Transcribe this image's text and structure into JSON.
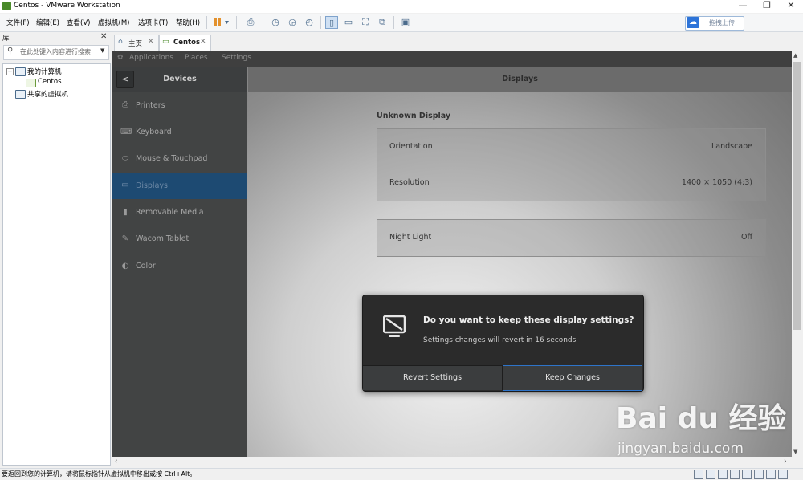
{
  "window": {
    "title": "Centos - VMware Workstation",
    "minimize": "—",
    "restore": "❐",
    "close": "✕"
  },
  "menu": [
    "文件(F)",
    "编辑(E)",
    "查看(V)",
    "虚拟机(M)",
    "选项卡(T)",
    "帮助(H)"
  ],
  "toolbar": {
    "upload_label": "拖拽上传",
    "icons": [
      "pause-icon",
      "send-keys-icon",
      "snapshot-icon",
      "snapshot-revert-icon",
      "snapshot-manager-icon",
      "console-view-icon",
      "unity-icon",
      "fullscreen-icon",
      "full-screen-switch-icon",
      "console-only-icon"
    ]
  },
  "library": {
    "title": "库",
    "close": "✕",
    "search_placeholder": "在此处键入内容进行搜索",
    "tree": {
      "root": "我的计算机",
      "child": "Centos",
      "shared": "共享的虚拟机"
    }
  },
  "tabs": [
    {
      "label": "主页",
      "close": "✕"
    },
    {
      "label": "Centos",
      "close": "✕"
    }
  ],
  "gnome": {
    "applications": "Applications",
    "places": "Places",
    "settings": "Settings"
  },
  "devices": {
    "title": "Devices",
    "back": "<",
    "items": [
      {
        "label": "Printers",
        "icon": "printer-icon"
      },
      {
        "label": "Keyboard",
        "icon": "keyboard-icon"
      },
      {
        "label": "Mouse & Touchpad",
        "icon": "mouse-icon"
      },
      {
        "label": "Displays",
        "icon": "display-icon",
        "selected": true
      },
      {
        "label": "Removable Media",
        "icon": "media-icon"
      },
      {
        "label": "Wacom Tablet",
        "icon": "tablet-icon"
      },
      {
        "label": "Color",
        "icon": "color-icon"
      }
    ]
  },
  "displays": {
    "title": "Displays",
    "monitor_name": "Unknown Display",
    "orientation_label": "Orientation",
    "orientation_value": "Landscape",
    "resolution_label": "Resolution",
    "resolution_value": "1400 × 1050 (4:3)",
    "night_light_label": "Night Light",
    "night_light_value": "Off"
  },
  "dialog": {
    "title": "Do you want to keep these display settings?",
    "subtitle": "Settings changes will revert in 16 seconds",
    "revert_label": "Revert Settings",
    "keep_label": "Keep Changes"
  },
  "watermark": {
    "logo": "Bai du 经验",
    "url": "jingyan.baidu.com"
  },
  "status": {
    "text": "要返回到您的计算机，请将鼠标指针从虚拟机中移出或按 Ctrl+Alt。"
  },
  "colors": {
    "selected_row": "#1d4a72",
    "keep_border": "#2e74c9",
    "dialog_bg": "#2b2b2b"
  }
}
